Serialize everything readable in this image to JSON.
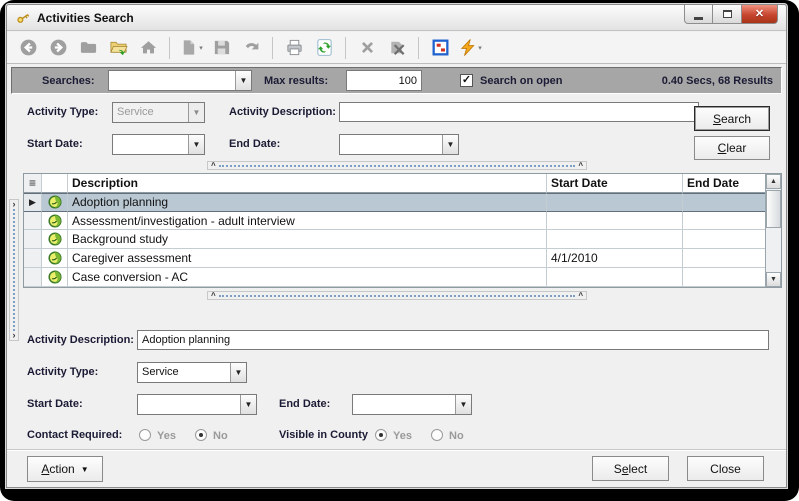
{
  "window": {
    "title": "Activities Search",
    "controls": [
      "minimize-button",
      "maximize-button",
      "close-button"
    ]
  },
  "toolbar": {
    "icons": [
      {
        "name": "back-icon",
        "enabled": false
      },
      {
        "name": "forward-icon",
        "enabled": false
      },
      {
        "name": "folder-icon",
        "enabled": false
      },
      {
        "name": "open-folder-icon",
        "enabled": true
      },
      {
        "name": "home-icon",
        "enabled": false
      },
      {
        "name": "new-page-icon",
        "enabled": false
      },
      {
        "name": "save-icon",
        "enabled": false
      },
      {
        "name": "undo-icon",
        "enabled": false
      },
      {
        "name": "print-icon",
        "enabled": true
      },
      {
        "name": "refresh-icon",
        "enabled": true
      },
      {
        "name": "delete-icon",
        "enabled": false
      },
      {
        "name": "clear-results-icon",
        "enabled": false
      },
      {
        "name": "form-window-icon",
        "enabled": true
      },
      {
        "name": "lightning-icon",
        "enabled": true
      }
    ]
  },
  "search_bar": {
    "searches_label": "Searches:",
    "searches_value": "",
    "max_results_label": "Max results:",
    "max_results_value": "100",
    "search_on_open_label": "Search on open",
    "search_on_open_checked": true,
    "status_text": "0.40 Secs, 68 Results"
  },
  "filter_form": {
    "activity_type_label": "Activity Type:",
    "activity_type_value": "Service",
    "activity_description_label": "Activity Description:",
    "activity_description_value": "",
    "start_date_label": "Start Date:",
    "start_date_value": "",
    "end_date_label": "End Date:",
    "end_date_value": "",
    "search_button": {
      "key": "S",
      "rest": "earch"
    },
    "clear_button": {
      "key": "C",
      "rest": "lear"
    }
  },
  "grid": {
    "columns": {
      "description": "Description",
      "start_date": "Start Date",
      "end_date": "End Date"
    },
    "rows": [
      {
        "description": "Adoption planning",
        "start_date": "",
        "end_date": "",
        "selected": true
      },
      {
        "description": "Assessment/investigation - adult interview",
        "start_date": "",
        "end_date": "",
        "selected": false
      },
      {
        "description": "Background study",
        "start_date": "",
        "end_date": "",
        "selected": false
      },
      {
        "description": "Caregiver assessment",
        "start_date": "4/1/2010",
        "end_date": "",
        "selected": false
      },
      {
        "description": "Case conversion - AC",
        "start_date": "",
        "end_date": "",
        "selected": false
      }
    ]
  },
  "detail": {
    "activity_description_label": "Activity Description:",
    "activity_description_value": "Adoption planning",
    "activity_type_label": "Activity Type:",
    "activity_type_value": "Service",
    "start_date_label": "Start Date:",
    "start_date_value": "",
    "end_date_label": "End Date:",
    "end_date_value": "",
    "contact_required_label": "Contact Required:",
    "contact_required": {
      "yes_selected": false,
      "no_selected": true
    },
    "visible_in_county_label": "Visible in County",
    "visible_in_county": {
      "yes_selected": true,
      "no_selected": false
    },
    "yes_label": "Yes",
    "no_label": "No"
  },
  "footer": {
    "action_button": {
      "key": "A",
      "rest": "ction"
    },
    "select_button": {
      "pre": "S",
      "key": "e",
      "rest": "lect"
    },
    "close_button": "Close"
  }
}
